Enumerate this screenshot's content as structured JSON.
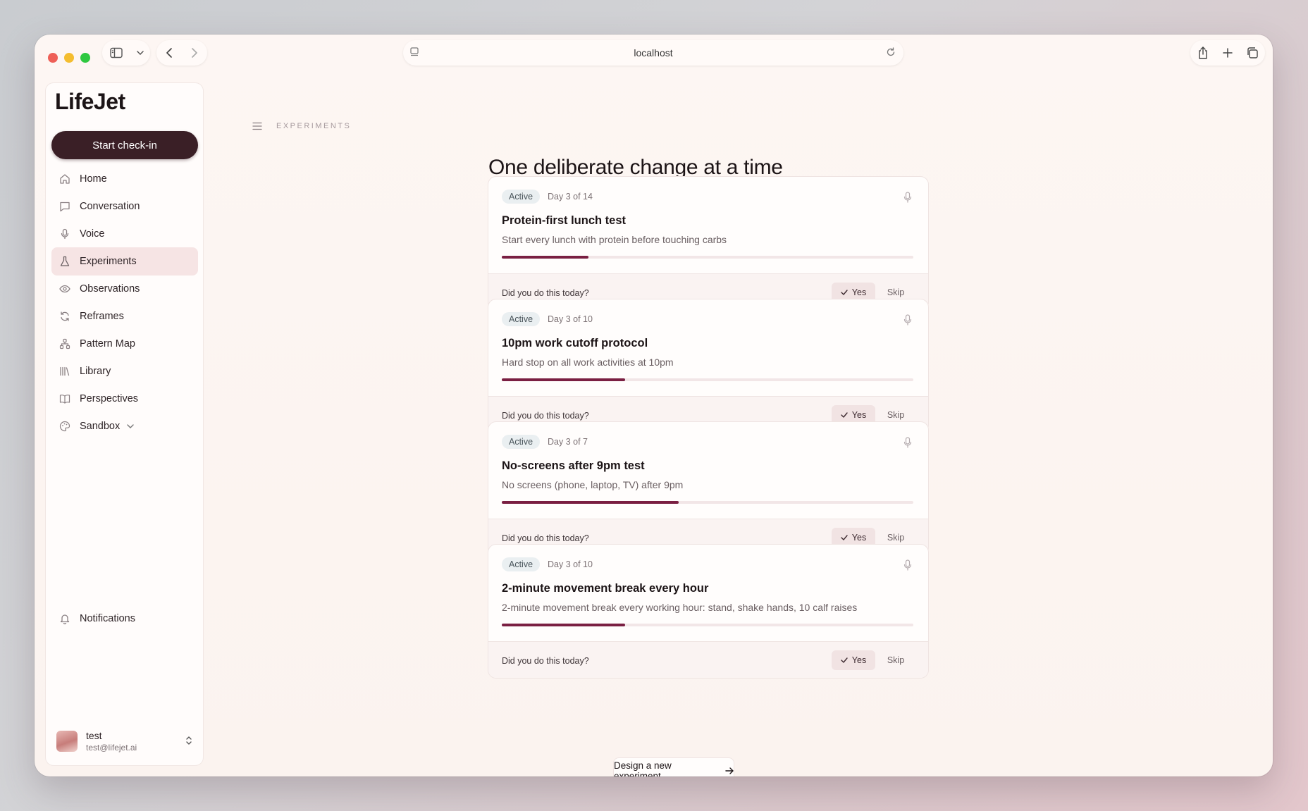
{
  "browser": {
    "url": "localhost"
  },
  "sidebar": {
    "logo": "LifeJet",
    "checkin_label": "Start check-in",
    "items": [
      {
        "label": "Home",
        "icon": "home-icon"
      },
      {
        "label": "Conversation",
        "icon": "chat-icon"
      },
      {
        "label": "Voice",
        "icon": "mic-icon"
      },
      {
        "label": "Experiments",
        "icon": "flask-icon",
        "active": true
      },
      {
        "label": "Observations",
        "icon": "eye-icon"
      },
      {
        "label": "Reframes",
        "icon": "refresh-icon"
      },
      {
        "label": "Pattern Map",
        "icon": "network-icon"
      },
      {
        "label": "Library",
        "icon": "library-icon"
      },
      {
        "label": "Perspectives",
        "icon": "book-icon"
      },
      {
        "label": "Sandbox",
        "icon": "palette-icon"
      }
    ],
    "notifications_label": "Notifications",
    "user": {
      "name": "test",
      "email": "test@lifejet.ai"
    }
  },
  "main": {
    "breadcrumb": "EXPERIMENTS",
    "title": "One deliberate change at a time",
    "experiments": [
      {
        "status": "Active",
        "day": "Day 3 of 14",
        "title": "Protein-first lunch test",
        "description": "Start every lunch with protein before touching carbs",
        "progress": 0.21,
        "question": "Did you do this today?",
        "yes": "Yes",
        "skip": "Skip"
      },
      {
        "status": "Active",
        "day": "Day 3 of 10",
        "title": "10pm work cutoff protocol",
        "description": "Hard stop on all work activities at 10pm",
        "progress": 0.3,
        "question": "Did you do this today?",
        "yes": "Yes",
        "skip": "Skip"
      },
      {
        "status": "Active",
        "day": "Day 3 of 7",
        "title": "No-screens after 9pm test",
        "description": "No screens (phone, laptop, TV) after 9pm",
        "progress": 0.43,
        "question": "Did you do this today?",
        "yes": "Yes",
        "skip": "Skip"
      },
      {
        "status": "Active",
        "day": "Day 3 of 10",
        "title": "2-minute movement break every hour",
        "description": "2-minute movement break every working hour: stand, shake hands, 10 calf raises",
        "progress": 0.3,
        "question": "Did you do this today?",
        "yes": "Yes",
        "skip": "Skip"
      }
    ],
    "design_label": "Design a new experiment"
  }
}
